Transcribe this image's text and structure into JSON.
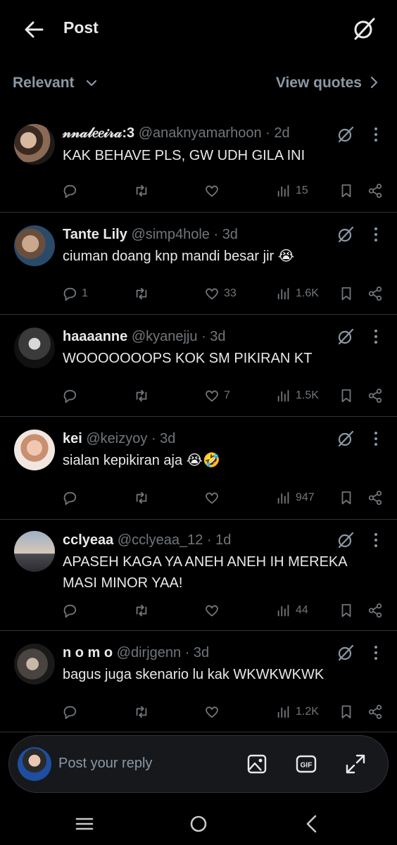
{
  "header": {
    "title": "Post",
    "back_icon": "arrow-left-icon",
    "grok_icon": "grok-icon"
  },
  "filter": {
    "sort_label": "Relevant",
    "quotes_label": "View quotes"
  },
  "colors": {
    "background": "#000000",
    "text": "#e7e9ea",
    "muted": "#71767b",
    "divider": "#2f3336"
  },
  "replies": [
    {
      "name": "𝓃𝓃𝒶𝓁𝑒𝑒𝒾𝓇𝒶:3",
      "handle": "@anaknyamarhoon",
      "time": "2d",
      "text": "KAK BEHAVE PLS, GW UDH GILA INI",
      "replies": "",
      "likes": "",
      "views": "15"
    },
    {
      "name": "Tante Lily",
      "handle": "@simp4hole",
      "time": "3d",
      "text": "ciuman doang knp mandi besar jir 😭",
      "replies": "1",
      "likes": "33",
      "views": "1.6K"
    },
    {
      "name": "haaaanne",
      "handle": "@kyanejju",
      "time": "3d",
      "text": "WOOOOOOOPS KOK SM PIKIRAN KT",
      "replies": "",
      "likes": "7",
      "views": "1.5K"
    },
    {
      "name": "kei",
      "handle": "@keizyoy",
      "time": "3d",
      "text": "sialan kepikiran aja 😭🤣",
      "replies": "",
      "likes": "",
      "views": "947"
    },
    {
      "name": "cclyeaa",
      "handle": "@cclyeaa_12",
      "time": "1d",
      "text": "APASEH KAGA YA ANEH ANEH IH MEREKA MASI MINOR YAA!",
      "replies": "",
      "likes": "",
      "views": "44"
    },
    {
      "name": "n o m o",
      "handle": "@dirjgenn",
      "time": "3d",
      "text": "bagus juga skenario lu kak WKWKWKWK",
      "replies": "",
      "likes": "",
      "views": "1.2K"
    }
  ],
  "composer": {
    "placeholder": "Post your reply",
    "image_icon": "image-icon",
    "gif_icon": "gif-icon",
    "expand_icon": "expand-icon"
  },
  "navbar": {
    "icons": [
      "menu-icon",
      "home-circle-icon",
      "back-chevron-icon"
    ]
  }
}
